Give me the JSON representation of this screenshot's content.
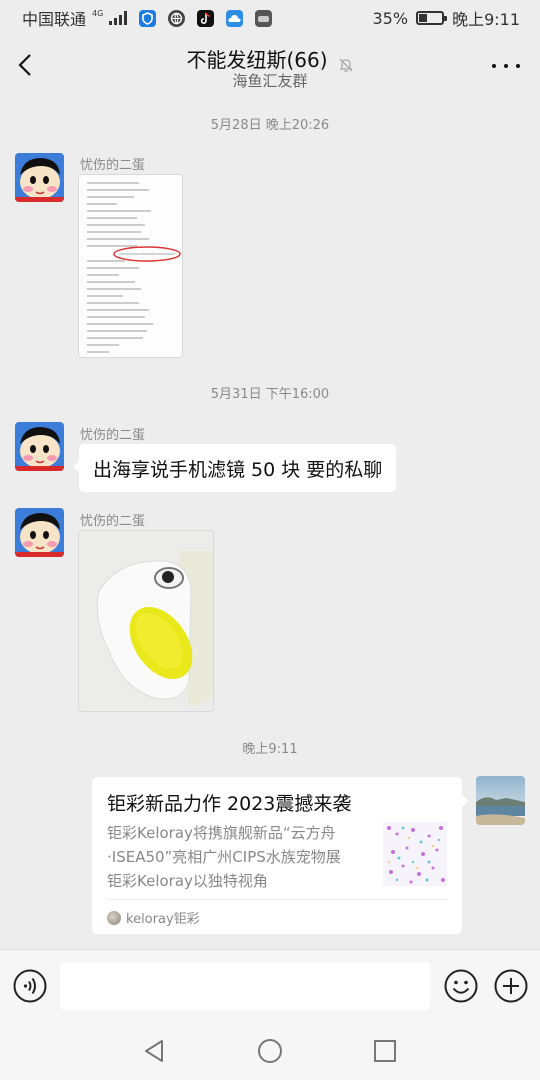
{
  "status_bar": {
    "carrier": "中国联通",
    "network": "4G",
    "battery": "35%",
    "battery_level": 0.35,
    "time": "晚上9:11"
  },
  "header": {
    "title": "不能发纽斯(66)",
    "subtitle": "海鱼汇友群",
    "back_icon": "chevron-left-icon",
    "mute_icon": "bell-off-icon",
    "more_icon": "ellipsis-icon"
  },
  "messages": {
    "ts1": "5月28日 晚上20:26",
    "ts2": "5月31日 下午16:00",
    "ts3": "晚上9:11",
    "sender1": "忧伤的二蛋",
    "sender2": "忧伤的二蛋",
    "sender3": "忧伤的二蛋",
    "text_message": "出海享说手机滤镜 50 块 要的私聊",
    "link_card": {
      "title": "钜彩新品力作 2023震撼来袭",
      "desc_lines": [
        "钜彩Keloray将携旗舰新品“云方舟",
        "·ISEA50”亮相广州CIPS水族宠物展",
        "钜彩Keloray以独特视角"
      ],
      "source": "keloray钜彩"
    }
  },
  "input_bar": {
    "voice_icon": "voice-icon",
    "emoji_icon": "emoji-icon",
    "plus_icon": "plus-circle-icon",
    "placeholder": ""
  },
  "nav_bar": {
    "back_icon": "triangle-back-icon",
    "home_icon": "circle-home-icon",
    "recents_icon": "square-recents-icon"
  },
  "colors": {
    "background": "#ededed",
    "bubble": "#ffffff",
    "timestamp": "#8a8a8a"
  }
}
